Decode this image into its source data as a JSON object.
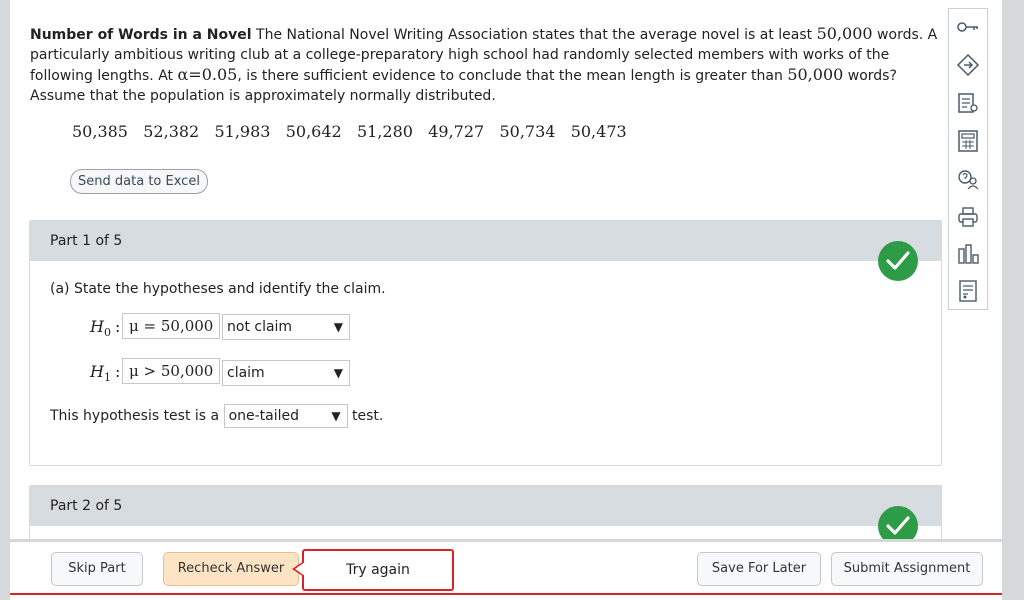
{
  "problem": {
    "title": "Number of Words in a Novel",
    "text_1": "The National Novel Writing Association states that the average novel is at least",
    "num_50000": "50,000",
    "text_2": "words. A particularly ambitious writing club at a college-preparatory high school had randomly selected members with works of the following lengths. At",
    "alpha_sym": "α",
    "alpha_eq": "=",
    "alpha_val": "0.05",
    "text_3": ", is there sufficient evidence to conclude that the mean length is greater than",
    "text_4": "words? Assume that the population is approximately normally distributed."
  },
  "data_values": "50,385   52,382   51,983   50,642   51,280   49,727   50,734   50,473",
  "send_excel_label": "Send data to Excel",
  "part1": {
    "header": "Part 1 of 5",
    "question": "(a) State the hypotheses and identify the claim.",
    "h0_label": "H",
    "h0_sub": "0",
    "h0_value": "μ = 50,000",
    "h0_claim": "not claim",
    "h1_label": "H",
    "h1_sub": "1",
    "h1_value": "μ > 50,000",
    "h1_claim": "claim",
    "test_prefix": "This hypothesis test is a",
    "test_select": "one-tailed",
    "test_suffix": "test.",
    "colon": ":",
    "arrow": "▼"
  },
  "part2": {
    "header": "Part 2 of 5"
  },
  "tools": [
    "key-icon",
    "reading-icon",
    "explain-icon",
    "calculator-icon",
    "glossary-icon",
    "print-icon",
    "chart-icon",
    "worksheet-icon"
  ],
  "footer": {
    "skip": "Skip Part",
    "recheck": "Recheck Answer",
    "try_again": "Try again",
    "save_later": "Save For Later",
    "submit": "Submit Assignment"
  },
  "colors": {
    "check_green": "#2e9b47",
    "error_red": "#d8232a",
    "recheck_bg": "#fbe3c4"
  }
}
